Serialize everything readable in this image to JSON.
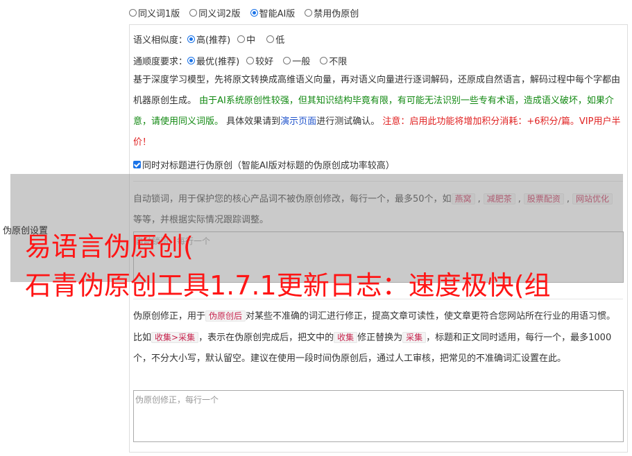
{
  "mode_options": [
    {
      "label": "同义词1版",
      "selected": false
    },
    {
      "label": "同义词2版",
      "selected": false
    },
    {
      "label": "智能AI版",
      "selected": true
    },
    {
      "label": "禁用伪原创",
      "selected": false
    }
  ],
  "similarity": {
    "label": "语义相似度：",
    "options": [
      {
        "label": "高(推荐)",
        "selected": true
      },
      {
        "label": "中",
        "selected": false
      },
      {
        "label": "低",
        "selected": false
      }
    ]
  },
  "fluency": {
    "label": "通顺度要求：",
    "options": [
      {
        "label": "最优(推荐)",
        "selected": true
      },
      {
        "label": "较好",
        "selected": false
      },
      {
        "label": "一般",
        "selected": false
      },
      {
        "label": "不限",
        "selected": false
      }
    ]
  },
  "description": {
    "p1": "基于深度学习模型，先将原文转换成高维语义向量，再对语义向量进行逐词解码，还原成自然语言，解码过程中每个字都由机器原创生成。",
    "green": "由于AI系统原创性较强，但其知识结构毕竟有限，有可能无法识别一些专有术语，造成语义破坏，如果介意，请使用同义词版。",
    "p2": "具体效果请到",
    "link": "演示页面",
    "p3": "进行测试确认。",
    "red": "注意：启用此功能将增加积分消耗：+6积分/篇。VIP用户半价！"
  },
  "title_checkbox": {
    "label": "同时对标题进行伪原创（智能AI版对标题的伪原创成功率较高）",
    "checked": true
  },
  "lock_words": {
    "desc_start": "自动锁词，用于保护您的核心产品词不被伪原创修改，每行一个，最多50个，如",
    "tags": [
      "燕窝",
      "减肥茶",
      "股票配资",
      "网站优化"
    ],
    "desc_end": "等等，并根据实际情况跟踪调整。",
    "placeholder": "自动锁词，每行一个"
  },
  "side_label": "伪原创设置",
  "overlay_title": {
    "line1": "易语言伪原创(",
    "line2": "石青伪原创工具1.7.1更新日志：速度极快(组"
  },
  "correction": {
    "d1": "伪原创修正，用于",
    "tag1": "伪原创后",
    "d2": "对某些不准确的词汇进行修正，提高文章可读性，使文章更符合您网站所在行业的用语习惯。比如",
    "tag2": "收集>采集",
    "d3": "，表示在伪原创完成后，把文中的",
    "tag3": "收集",
    "d4": "修正替换为",
    "tag4": "采集",
    "d5": "，标题和正文同时适用，每行一个，最多1000个，不分大小写，默认留空。建议在使用一段时间伪原创后，通过人工审核，把常见的不准确词汇设置在此。",
    "placeholder": "伪原创修正，每行一个"
  }
}
